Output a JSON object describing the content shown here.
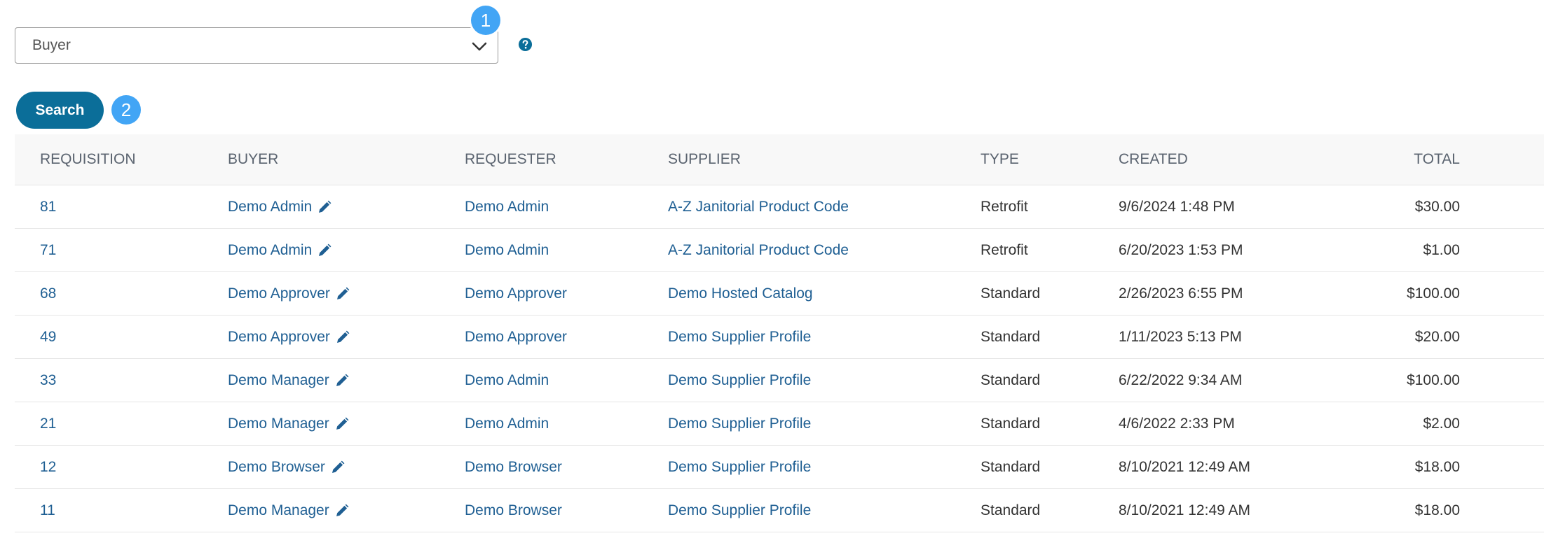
{
  "filter": {
    "selected": "Buyer",
    "badge": "1"
  },
  "search": {
    "label": "Search",
    "badge": "2"
  },
  "table": {
    "headers": {
      "requisition": "REQUISITION",
      "buyer": "BUYER",
      "requester": "REQUESTER",
      "supplier": "SUPPLIER",
      "type": "TYPE",
      "created": "CREATED",
      "total": "TOTAL"
    },
    "rows": [
      {
        "requisition": "81",
        "buyer": "Demo Admin",
        "requester": "Demo Admin",
        "supplier": "A-Z Janitorial Product Code",
        "type": "Retrofit",
        "created": "9/6/2024 1:48 PM",
        "total": "$30.00"
      },
      {
        "requisition": "71",
        "buyer": "Demo Admin",
        "requester": "Demo Admin",
        "supplier": "A-Z Janitorial Product Code",
        "type": "Retrofit",
        "created": "6/20/2023 1:53 PM",
        "total": "$1.00"
      },
      {
        "requisition": "68",
        "buyer": "Demo Approver",
        "requester": "Demo Approver",
        "supplier": "Demo Hosted Catalog",
        "type": "Standard",
        "created": "2/26/2023 6:55 PM",
        "total": "$100.00"
      },
      {
        "requisition": "49",
        "buyer": "Demo Approver",
        "requester": "Demo Approver",
        "supplier": "Demo Supplier Profile",
        "type": "Standard",
        "created": "1/11/2023 5:13 PM",
        "total": "$20.00"
      },
      {
        "requisition": "33",
        "buyer": "Demo Manager",
        "requester": "Demo Admin",
        "supplier": "Demo Supplier Profile",
        "type": "Standard",
        "created": "6/22/2022 9:34 AM",
        "total": "$100.00"
      },
      {
        "requisition": "21",
        "buyer": "Demo Manager",
        "requester": "Demo Admin",
        "supplier": "Demo Supplier Profile",
        "type": "Standard",
        "created": "4/6/2022 2:33 PM",
        "total": "$2.00"
      },
      {
        "requisition": "12",
        "buyer": "Demo Browser",
        "requester": "Demo Browser",
        "supplier": "Demo Supplier Profile",
        "type": "Standard",
        "created": "8/10/2021 12:49 AM",
        "total": "$18.00"
      },
      {
        "requisition": "11",
        "buyer": "Demo Manager",
        "requester": "Demo Browser",
        "supplier": "Demo Supplier Profile",
        "type": "Standard",
        "created": "8/10/2021 12:49 AM",
        "total": "$18.00"
      }
    ]
  },
  "colors": {
    "link": "#1f5f93",
    "primary_button": "#0b6e99",
    "step_badge": "#42a5f5",
    "help_icon": "#0b6e99"
  },
  "icons": {
    "select_chevron": "chevron-down-icon",
    "help": "question-circle-icon",
    "edit_buyer": "pencil-icon"
  }
}
